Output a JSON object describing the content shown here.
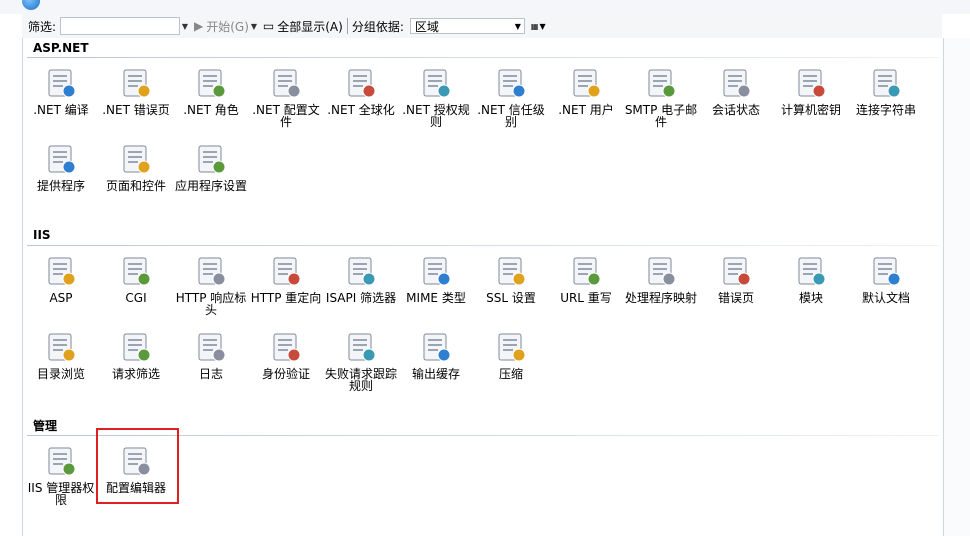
{
  "toolbar": {
    "filter_label": "筛选:",
    "filter_value": "",
    "start_label": "开始(G)",
    "show_all_label": "全部显示(A)",
    "group_by_label": "分组依据:",
    "group_by_value": "区域"
  },
  "sections": [
    {
      "title": "ASP.NET",
      "items": [
        ".NET 编译",
        ".NET 错误页",
        ".NET 角色",
        ".NET 配置文件",
        ".NET 全球化",
        ".NET 授权规则",
        ".NET 信任级别",
        ".NET 用户",
        "SMTP 电子邮件",
        "会话状态",
        "计算机密钥",
        "连接字符串",
        "提供程序",
        "页面和控件",
        "应用程序设置"
      ]
    },
    {
      "title": "IIS",
      "items": [
        "ASP",
        "CGI",
        "HTTP 响应标头",
        "HTTP 重定向",
        "ISAPI 筛选器",
        "MIME 类型",
        "SSL 设置",
        "URL 重写",
        "处理程序映射",
        "错误页",
        "模块",
        "默认文档",
        "目录浏览",
        "请求筛选",
        "日志",
        "身份验证",
        "失败请求跟踪规则",
        "输出缓存",
        "压缩"
      ]
    },
    {
      "title": "管理",
      "items": [
        "IIS 管理器权限",
        "配置编辑器"
      ]
    }
  ]
}
